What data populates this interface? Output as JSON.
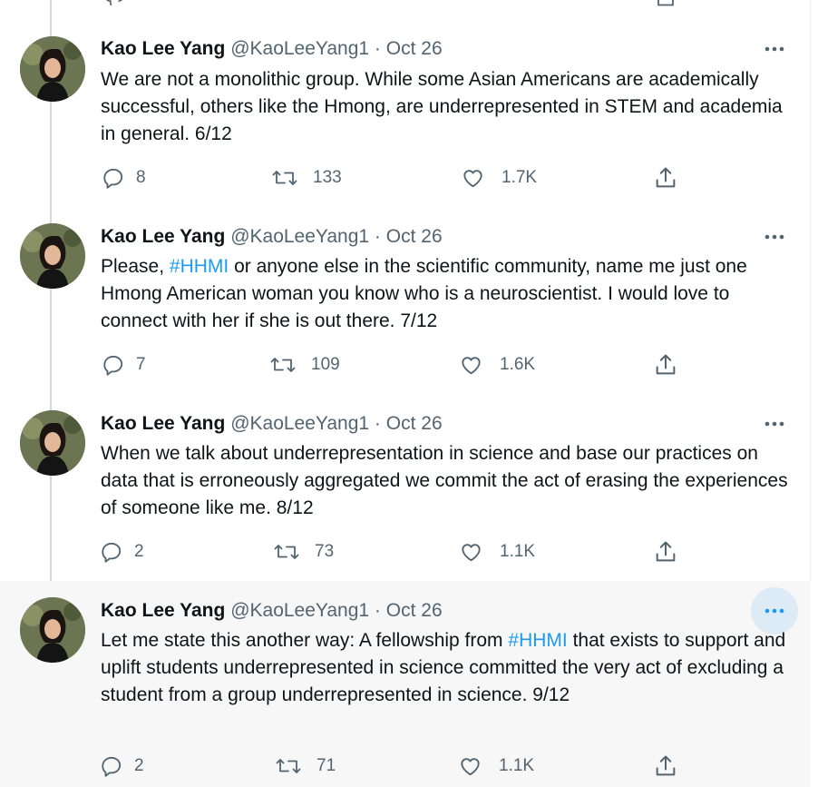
{
  "tweets": [
    {
      "author": "Kao Lee Yang",
      "handle": "@KaoLeeYang1",
      "separator": "·",
      "date": "Oct 26",
      "text_parts": [
        "We are not a monolithic group. While some Asian Americans are academically successful, others like the Hmong, are underrepresented in STEM and academia in general. 6/12"
      ],
      "replies": "8",
      "retweets": "133",
      "likes": "1.7K"
    },
    {
      "author": "Kao Lee Yang",
      "handle": "@KaoLeeYang1",
      "separator": "·",
      "date": "Oct 26",
      "text_parts": [
        "Please, ",
        "#HHMI",
        " or anyone else in the scientific community, name me just one Hmong American woman you know who is a neuroscientist. I would love to connect with her if she is out there. 7/12"
      ],
      "replies": "7",
      "retweets": "109",
      "likes": "1.6K"
    },
    {
      "author": "Kao Lee Yang",
      "handle": "@KaoLeeYang1",
      "separator": "·",
      "date": "Oct 26",
      "text_parts": [
        "When we talk about underrepresentation in science and base our practices on data that is erroneously aggregated we commit the act of erasing the experiences of someone like me. 8/12"
      ],
      "replies": "2",
      "retweets": "73",
      "likes": "1.1K"
    },
    {
      "author": "Kao Lee Yang",
      "handle": "@KaoLeeYang1",
      "separator": "·",
      "date": "Oct 26",
      "text_parts": [
        "Let me state this another way: A fellowship from ",
        "#HHMI",
        " that exists to support and uplift students underrepresented in science committed the very act of excluding a student from a group underrepresented in science. 9/12"
      ],
      "replies": "2",
      "retweets": "71",
      "likes": "1.1K"
    }
  ],
  "icons": {
    "more": "more-horizontal-icon",
    "reply": "reply-icon",
    "retweet": "retweet-icon",
    "like": "heart-icon",
    "share": "share-icon"
  },
  "colors": {
    "hashtag": "#1d9bf0",
    "secondary_text": "#536471",
    "primary_text": "#0f1419",
    "thread_line": "#cfd9de",
    "hover_background": "#f7f7f7",
    "more_button_hover": "#dcebf5"
  }
}
